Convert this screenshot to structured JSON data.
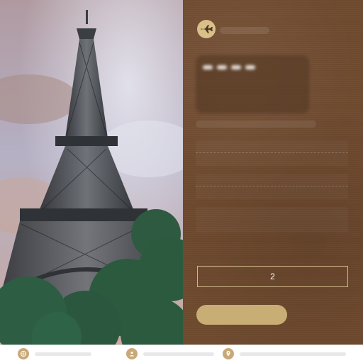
{
  "screen": {
    "hero": {
      "image_name": "eiffel-tower-photo"
    },
    "panel": {
      "logo": {
        "icon": "airplane-icon",
        "color": "#d9c089"
      },
      "code_input": {
        "value": "2",
        "placeholder": ""
      },
      "submit_button": {
        "label": "",
        "color": "#c8ae75"
      },
      "background_color": "#6f4a2f",
      "accent_color": "#cdb68a"
    },
    "bottom_nav": {
      "items": [
        {
          "icon": "globe-icon",
          "label": ""
        },
        {
          "icon": "user-icon",
          "label": ""
        },
        {
          "icon": "map-pin-icon",
          "label": ""
        }
      ],
      "icon_color": "#c9a978"
    }
  }
}
